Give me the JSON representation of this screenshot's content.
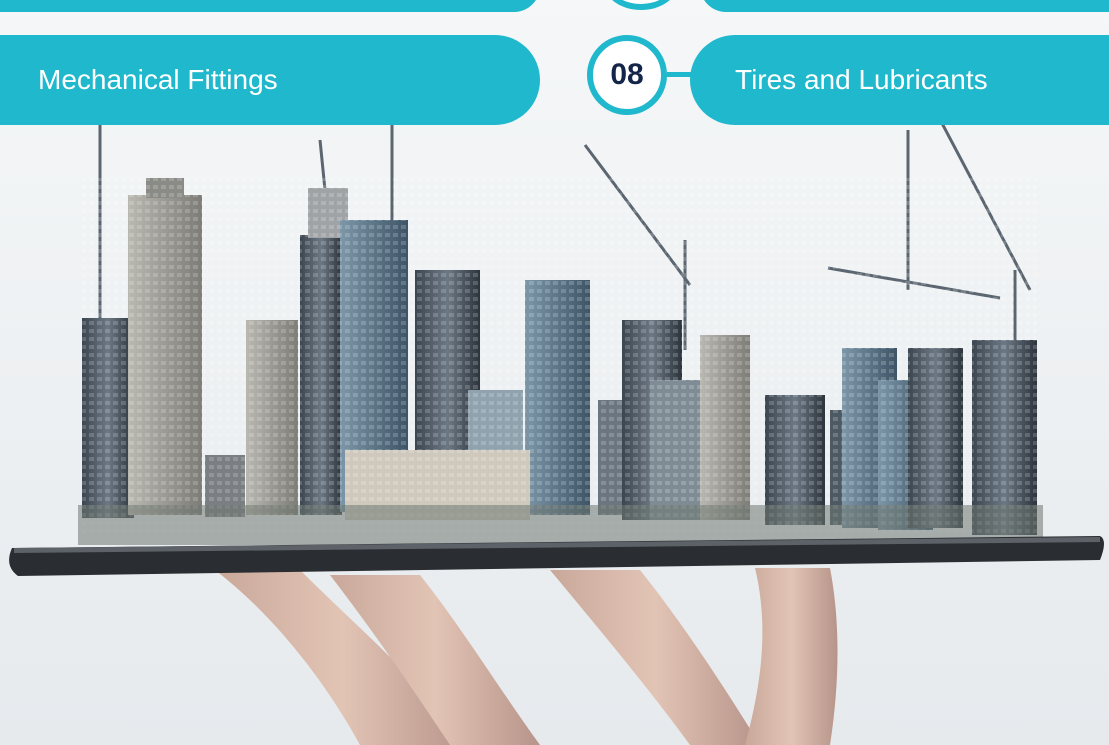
{
  "left_item": {
    "label": "Mechanical Fittings"
  },
  "right_item": {
    "number": "08",
    "label": "Tires and Lubricants"
  },
  "colors": {
    "accent": "#1fb8cc",
    "number_text": "#14254a",
    "sky": "#eef1f3",
    "tablet": "#2a2e32"
  }
}
